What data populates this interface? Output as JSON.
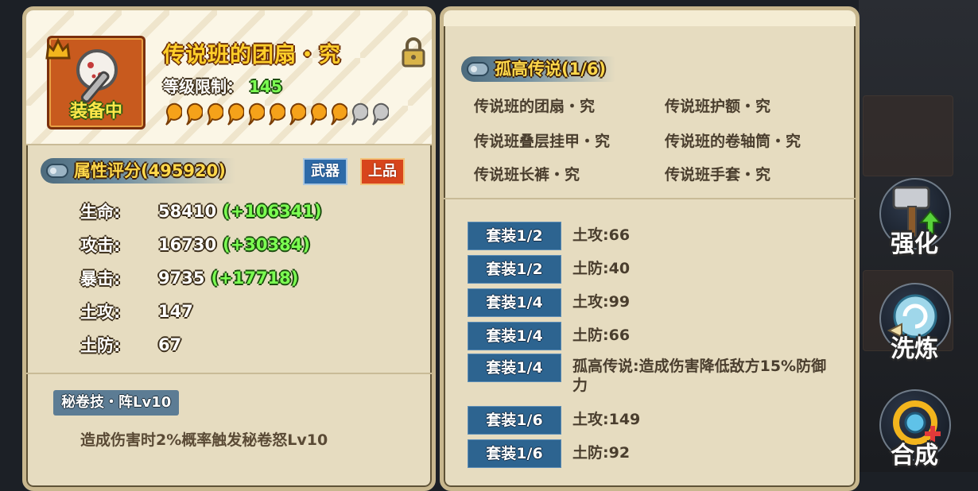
{
  "item": {
    "name": "传说班的团扇・究",
    "equipped_label": "装备中",
    "level_label": "等级限制：",
    "level_value": "145",
    "stars_filled": 9,
    "stars_total": 11,
    "rank_icon": "rank-crown-icon",
    "lock_icon": "lock-icon"
  },
  "attributes": {
    "title": "属性评分(495920)",
    "type_badge": "武器",
    "grade_badge": "上品",
    "stats": [
      {
        "label": "生命:",
        "value": "58410",
        "bonus": "(+106341)"
      },
      {
        "label": "攻击:",
        "value": "16730",
        "bonus": "(+30384)"
      },
      {
        "label": "暴击:",
        "value": "9735",
        "bonus": "(+17718)"
      },
      {
        "label": "土攻:",
        "value": "147",
        "bonus": ""
      },
      {
        "label": "土防:",
        "value": "67",
        "bonus": ""
      }
    ]
  },
  "skill": {
    "name": "秘卷技・阵Lv10",
    "description": "造成伤害时2%概率触发秘卷怒Lv10"
  },
  "set": {
    "title": "孤高传说(1/6)",
    "pieces": [
      "传说班的团扇・究",
      "传说班护额・究",
      "传说班叠层挂甲・究",
      "传说班的卷轴筒・究",
      "传说班长裤・究",
      "传说班手套・究"
    ],
    "bonuses": [
      {
        "req": "套装1/2",
        "effect": "土攻:66"
      },
      {
        "req": "套装1/2",
        "effect": "土防:40"
      },
      {
        "req": "套装1/4",
        "effect": "土攻:99"
      },
      {
        "req": "套装1/4",
        "effect": "土防:66"
      },
      {
        "req": "套装1/4",
        "effect": "孤高传说:造成伤害降低敌方15%防御力"
      },
      {
        "req": "套装1/6",
        "effect": "土攻:149"
      },
      {
        "req": "套装1/6",
        "effect": "土防:92"
      }
    ]
  },
  "actions": [
    {
      "label": "强化",
      "icon": "hammer-icon"
    },
    {
      "label": "洗炼",
      "icon": "swirl-icon"
    },
    {
      "label": "合成",
      "icon": "merge-icon"
    }
  ],
  "colors": {
    "panel": "#e6dcc0",
    "name_gold": "#ffcf2a",
    "bonus_green": "#7cff52",
    "chip_blue": "#2d6490"
  }
}
